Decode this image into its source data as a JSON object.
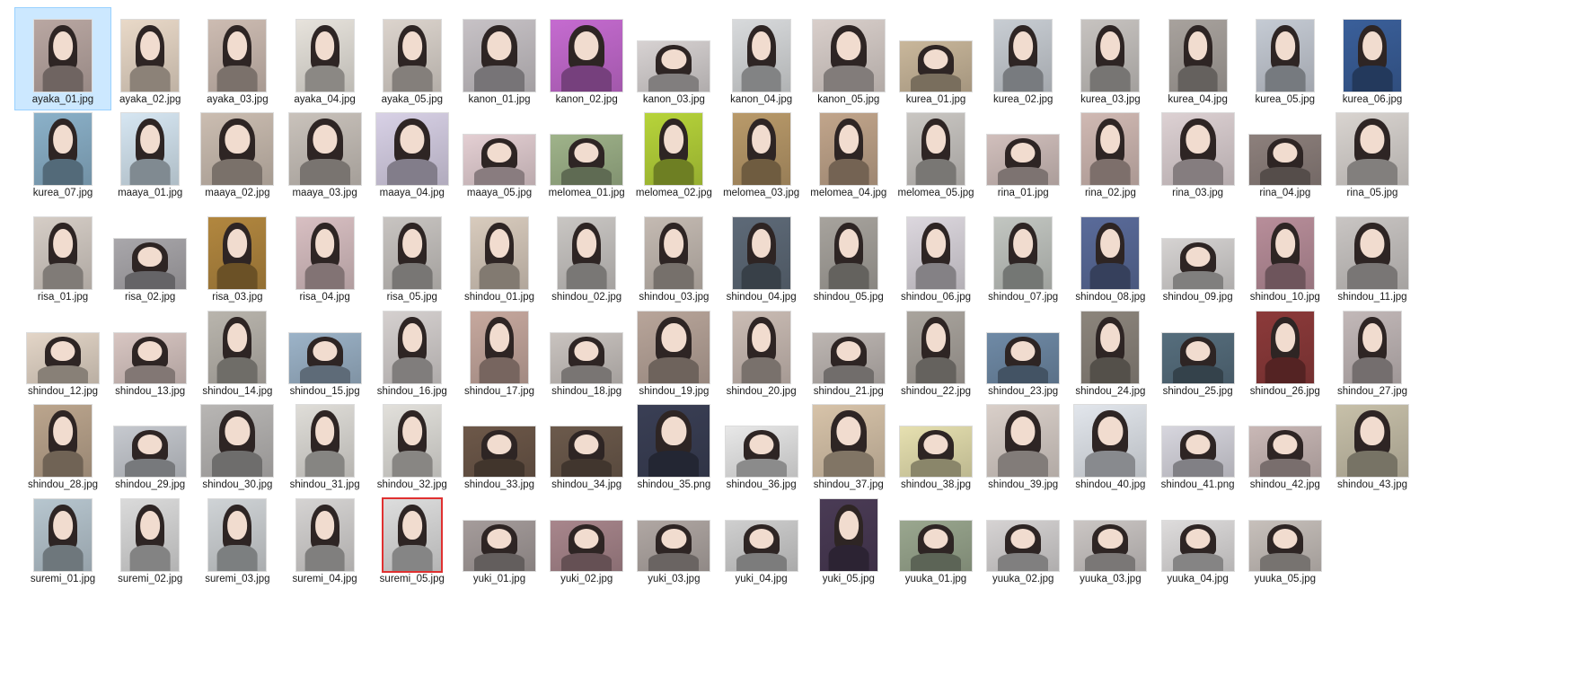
{
  "selected_file": "ayaka_01.jpg",
  "highlighted_file": "suremi_05.jpg",
  "rows": [
    [
      {
        "name": "ayaka_01.jpg",
        "shape": "p",
        "tone": "#b9a7a2"
      },
      {
        "name": "ayaka_02.jpg",
        "shape": "p",
        "tone": "#e9d9c8"
      },
      {
        "name": "ayaka_03.jpg",
        "shape": "p",
        "tone": "#cdbcb2"
      },
      {
        "name": "ayaka_04.jpg",
        "shape": "p",
        "tone": "#e7e3dc"
      },
      {
        "name": "ayaka_05.jpg",
        "shape": "p",
        "tone": "#dcd4cd"
      },
      {
        "name": "kanon_01.jpg",
        "shape": "s",
        "tone": "#c7c2c6"
      },
      {
        "name": "kanon_02.jpg",
        "shape": "s",
        "tone": "#c56bd0"
      },
      {
        "name": "kanon_03.jpg",
        "shape": "l",
        "tone": "#d7d2d2"
      },
      {
        "name": "kanon_04.jpg",
        "shape": "p",
        "tone": "#d8dadc"
      },
      {
        "name": "kanon_05.jpg",
        "shape": "s",
        "tone": "#d9cfcb"
      },
      {
        "name": "kurea_01.jpg",
        "shape": "l",
        "tone": "#c9b79b"
      },
      {
        "name": "kurea_02.jpg",
        "shape": "p",
        "tone": "#c8cdd3"
      },
      {
        "name": "kurea_03.jpg",
        "shape": "p",
        "tone": "#c7c3c0"
      },
      {
        "name": "kurea_04.jpg",
        "shape": "p",
        "tone": "#a8a29d"
      },
      {
        "name": "kurea_05.jpg",
        "shape": "p",
        "tone": "#c5cbd4"
      },
      {
        "name": "kurea_06.jpg",
        "shape": "p",
        "tone": "#3a5f9a"
      }
    ],
    [
      {
        "name": "kurea_07.jpg",
        "shape": "p",
        "tone": "#8bb1c9"
      },
      {
        "name": "maaya_01.jpg",
        "shape": "p",
        "tone": "#d6e6f2"
      },
      {
        "name": "maaya_02.jpg",
        "shape": "s",
        "tone": "#cbbdb1"
      },
      {
        "name": "maaya_03.jpg",
        "shape": "s",
        "tone": "#c9c2bb"
      },
      {
        "name": "maaya_04.jpg",
        "shape": "s",
        "tone": "#d8d1e6"
      },
      {
        "name": "maaya_05.jpg",
        "shape": "l",
        "tone": "#e4cfd3"
      },
      {
        "name": "melomea_01.jpg",
        "shape": "l",
        "tone": "#9fb38a"
      },
      {
        "name": "melomea_02.jpg",
        "shape": "p",
        "tone": "#b7d43a"
      },
      {
        "name": "melomea_03.jpg",
        "shape": "p",
        "tone": "#b99a6a"
      },
      {
        "name": "melomea_04.jpg",
        "shape": "p",
        "tone": "#c1a58b"
      },
      {
        "name": "melomea_05.jpg",
        "shape": "p",
        "tone": "#c9c6c2"
      },
      {
        "name": "rina_01.jpg",
        "shape": "l",
        "tone": "#d1bfbc"
      },
      {
        "name": "rina_02.jpg",
        "shape": "p",
        "tone": "#d0b9b3"
      },
      {
        "name": "rina_03.jpg",
        "shape": "s",
        "tone": "#ddd1d3"
      },
      {
        "name": "rina_04.jpg",
        "shape": "l",
        "tone": "#8d807c"
      },
      {
        "name": "rina_05.jpg",
        "shape": "s",
        "tone": "#d9d4d0"
      }
    ],
    [
      {
        "name": "risa_01.jpg",
        "shape": "p",
        "tone": "#d5cdc6"
      },
      {
        "name": "risa_02.jpg",
        "shape": "l",
        "tone": "#a9a7ab"
      },
      {
        "name": "risa_03.jpg",
        "shape": "p",
        "tone": "#b2873f"
      },
      {
        "name": "risa_04.jpg",
        "shape": "p",
        "tone": "#d8bfc2"
      },
      {
        "name": "risa_05.jpg",
        "shape": "p",
        "tone": "#c8c4c1"
      },
      {
        "name": "shindou_01.jpg",
        "shape": "p",
        "tone": "#d8cbbd"
      },
      {
        "name": "shindou_02.jpg",
        "shape": "p",
        "tone": "#c9c6c3"
      },
      {
        "name": "shindou_03.jpg",
        "shape": "p",
        "tone": "#c4bab2"
      },
      {
        "name": "shindou_04.jpg",
        "shape": "p",
        "tone": "#5e6a78"
      },
      {
        "name": "shindou_05.jpg",
        "shape": "p",
        "tone": "#a7a39d"
      },
      {
        "name": "shindou_06.jpg",
        "shape": "p",
        "tone": "#dcd7de"
      },
      {
        "name": "shindou_07.jpg",
        "shape": "p",
        "tone": "#c2c6c1"
      },
      {
        "name": "shindou_08.jpg",
        "shape": "p",
        "tone": "#5a6b9a"
      },
      {
        "name": "shindou_09.jpg",
        "shape": "l",
        "tone": "#d6d3d2"
      },
      {
        "name": "shindou_10.jpg",
        "shape": "p",
        "tone": "#b88e9a"
      },
      {
        "name": "shindou_11.jpg",
        "shape": "s",
        "tone": "#c9c5c3"
      }
    ],
    [
      {
        "name": "shindou_12.jpg",
        "shape": "l",
        "tone": "#e3d5c7"
      },
      {
        "name": "shindou_13.jpg",
        "shape": "l",
        "tone": "#d8c6c2"
      },
      {
        "name": "shindou_14.jpg",
        "shape": "p",
        "tone": "#b9b5ad"
      },
      {
        "name": "shindou_15.jpg",
        "shape": "l",
        "tone": "#9cb3c8"
      },
      {
        "name": "shindou_16.jpg",
        "shape": "p",
        "tone": "#d5d0cf"
      },
      {
        "name": "shindou_17.jpg",
        "shape": "p",
        "tone": "#c6a89e"
      },
      {
        "name": "shindou_18.jpg",
        "shape": "l",
        "tone": "#c9c3bf"
      },
      {
        "name": "shindou_19.jpg",
        "shape": "s",
        "tone": "#b8a59a"
      },
      {
        "name": "shindou_20.jpg",
        "shape": "p",
        "tone": "#cabcb4"
      },
      {
        "name": "shindou_21.jpg",
        "shape": "l",
        "tone": "#bdb6b2"
      },
      {
        "name": "shindou_22.jpg",
        "shape": "p",
        "tone": "#a9a49d"
      },
      {
        "name": "shindou_23.jpg",
        "shape": "l",
        "tone": "#6f8aa6"
      },
      {
        "name": "shindou_24.jpg",
        "shape": "p",
        "tone": "#8c857c"
      },
      {
        "name": "shindou_25.jpg",
        "shape": "l",
        "tone": "#566e7d"
      },
      {
        "name": "shindou_26.jpg",
        "shape": "p",
        "tone": "#8c3a3a"
      },
      {
        "name": "shindou_27.jpg",
        "shape": "p",
        "tone": "#c2b8b8"
      }
    ],
    [
      {
        "name": "shindou_28.jpg",
        "shape": "p",
        "tone": "#bba58d"
      },
      {
        "name": "shindou_29.jpg",
        "shape": "l",
        "tone": "#c6c9cf"
      },
      {
        "name": "shindou_30.jpg",
        "shape": "s",
        "tone": "#b8b6b4"
      },
      {
        "name": "shindou_31.jpg",
        "shape": "p",
        "tone": "#dfddd8"
      },
      {
        "name": "shindou_32.jpg",
        "shape": "p",
        "tone": "#e2e0db"
      },
      {
        "name": "shindou_33.jpg",
        "shape": "l",
        "tone": "#6d5849"
      },
      {
        "name": "shindou_34.jpg",
        "shape": "l",
        "tone": "#6c5a4c"
      },
      {
        "name": "shindou_35.png",
        "shape": "s",
        "tone": "#3a3f55"
      },
      {
        "name": "shindou_36.jpg",
        "shape": "l",
        "tone": "#e8e8e8"
      },
      {
        "name": "shindou_37.jpg",
        "shape": "s",
        "tone": "#d7c3a9"
      },
      {
        "name": "shindou_38.jpg",
        "shape": "l",
        "tone": "#e6e0b0"
      },
      {
        "name": "shindou_39.jpg",
        "shape": "s",
        "tone": "#d9cfc9"
      },
      {
        "name": "shindou_40.jpg",
        "shape": "s",
        "tone": "#e2e6ec"
      },
      {
        "name": "shindou_41.png",
        "shape": "l",
        "tone": "#d7d6de"
      },
      {
        "name": "shindou_42.jpg",
        "shape": "l",
        "tone": "#c9b8b6"
      },
      {
        "name": "shindou_43.jpg",
        "shape": "s",
        "tone": "#c7c0a9"
      }
    ],
    [
      {
        "name": "suremi_01.jpg",
        "shape": "p",
        "tone": "#b7c6cf"
      },
      {
        "name": "suremi_02.jpg",
        "shape": "p",
        "tone": "#dadada"
      },
      {
        "name": "suremi_03.jpg",
        "shape": "p",
        "tone": "#cfd3d6"
      },
      {
        "name": "suremi_04.jpg",
        "shape": "p",
        "tone": "#d5d3d2"
      },
      {
        "name": "suremi_05.jpg",
        "shape": "p",
        "tone": "#dddddd"
      },
      {
        "name": "yuki_01.jpg",
        "shape": "l",
        "tone": "#a59c9b"
      },
      {
        "name": "yuki_02.jpg",
        "shape": "l",
        "tone": "#a8868c"
      },
      {
        "name": "yuki_03.jpg",
        "shape": "l",
        "tone": "#b0a7a3"
      },
      {
        "name": "yuki_04.jpg",
        "shape": "l",
        "tone": "#cfcfcf"
      },
      {
        "name": "yuki_05.jpg",
        "shape": "p",
        "tone": "#4a3b55"
      },
      {
        "name": "yuuka_01.jpg",
        "shape": "l",
        "tone": "#9aa78f"
      },
      {
        "name": "yuuka_02.jpg",
        "shape": "l",
        "tone": "#d6d3d3"
      },
      {
        "name": "yuuka_03.jpg",
        "shape": "l",
        "tone": "#cbc6c4"
      },
      {
        "name": "yuuka_04.jpg",
        "shape": "l",
        "tone": "#dedcdc"
      },
      {
        "name": "yuuka_05.jpg",
        "shape": "l",
        "tone": "#c7c0bb"
      }
    ]
  ]
}
